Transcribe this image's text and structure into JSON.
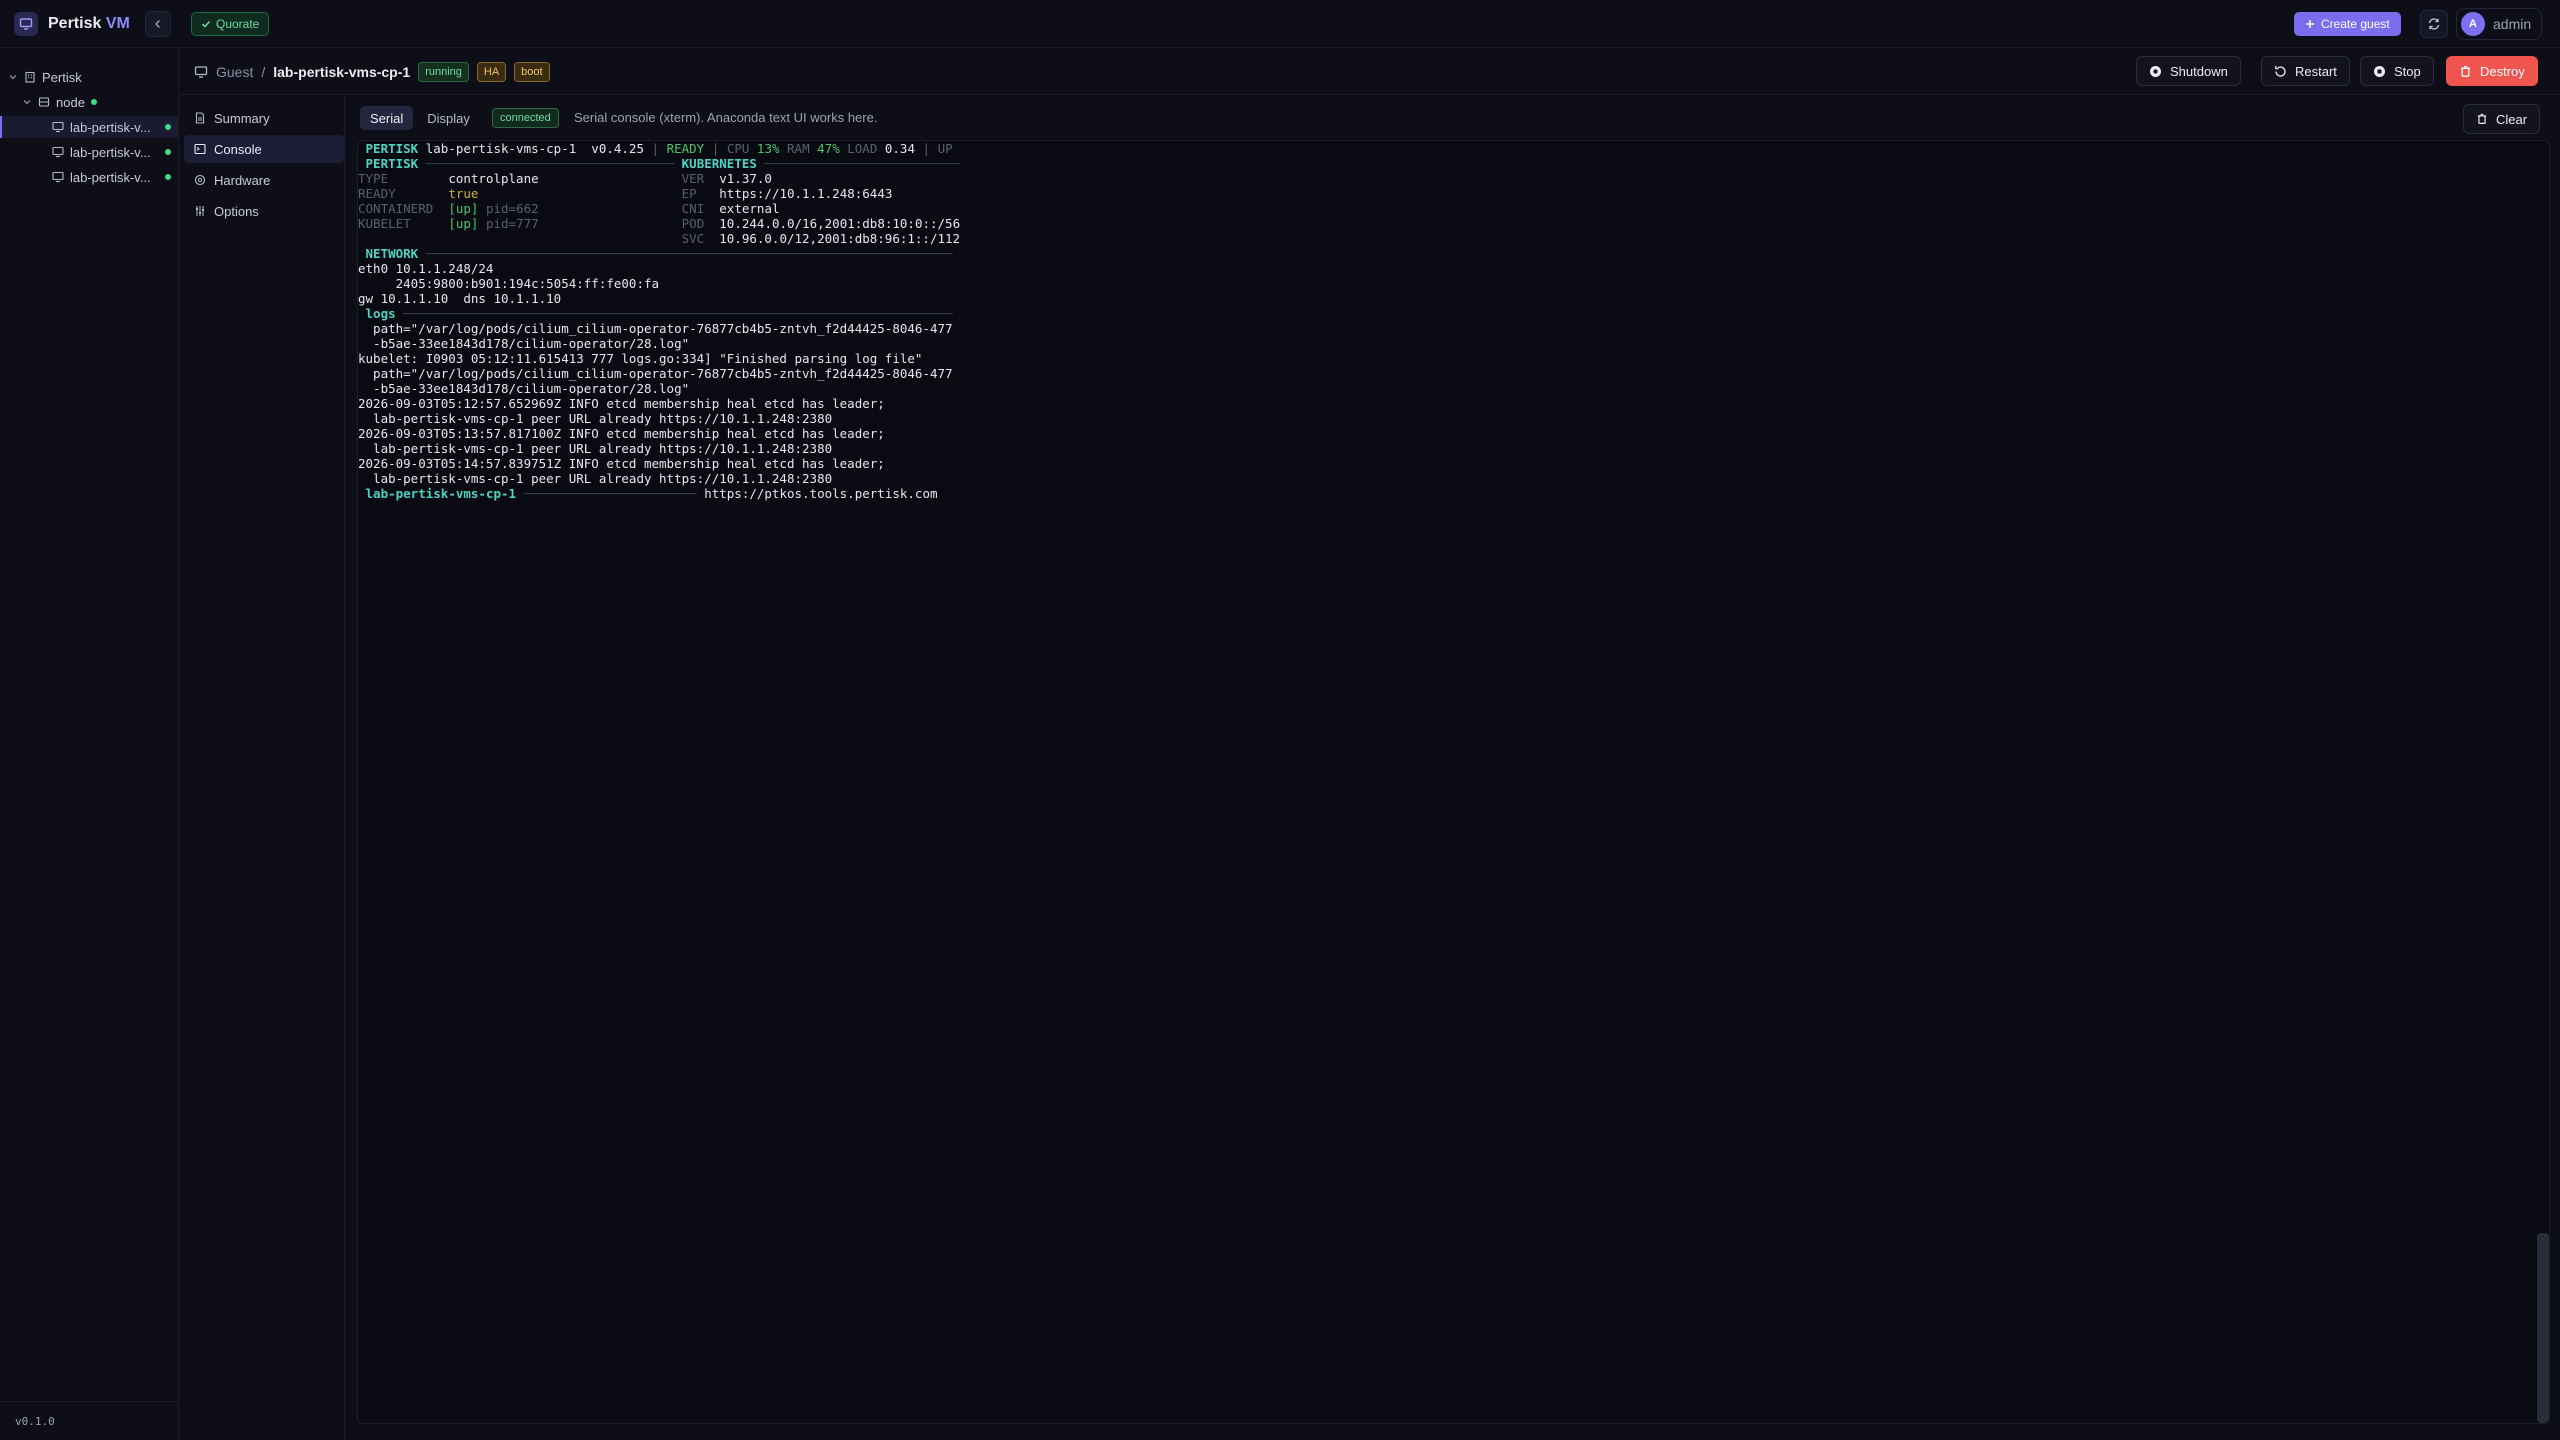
{
  "app": {
    "brand_primary": "Pertisk",
    "brand_accent": "VM",
    "quorate_label": "Quorate",
    "create_guest_label": "Create guest",
    "user_initial": "A",
    "user_name": "admin"
  },
  "sidebar": {
    "root_label": "Pertisk",
    "node_label": "node",
    "guests": [
      {
        "label": "lab-pertisk-v...",
        "status": "running"
      },
      {
        "label": "lab-pertisk-v...",
        "status": "running"
      },
      {
        "label": "lab-pertisk-v...",
        "status": "running"
      }
    ],
    "version": "v0.1.0"
  },
  "header": {
    "crumb_root": "Guest",
    "crumb_separator": "/",
    "crumb_current": "lab-pertisk-vms-cp-1",
    "badges": [
      "running",
      "HA",
      "boot"
    ],
    "actions": {
      "shutdown": "Shutdown",
      "restart": "Restart",
      "stop": "Stop",
      "destroy": "Destroy"
    }
  },
  "subnav": {
    "items": [
      "Summary",
      "Console",
      "Hardware",
      "Options"
    ],
    "active": "Console"
  },
  "console": {
    "tabs": [
      "Serial",
      "Display"
    ],
    "active_tab": "Serial",
    "status": "connected",
    "hint": "Serial console (xterm). Anaconda text UI works here.",
    "clear_label": "Clear",
    "lines": [
      " PERTISK lab-pertisk-vms-cp-1  v0.4.25 | READY | CPU 13% RAM 47% LOAD 0.34 | UP",
      " PERTISK ───────────────────────────────── KUBERNETES ──────────────────────────",
      "TYPE        controlplane                   VER  v1.37.0",
      "READY       true                           EP   https://10.1.1.248:6443",
      "CONTAINERD  [up] pid=662                   CNI  external",
      "KUBELET     [up] pid=777                   POD  10.244.0.0/16,2001:db8:10:0::/56",
      "                                           SVC  10.96.0.0/12,2001:db8:96:1::/112",
      " NETWORK ──────────────────────────────────────────────────────────────────────",
      "eth0 10.1.1.248/24",
      "     2405:9800:b901:194c:5054:ff:fe00:fa",
      "gw 10.1.1.10  dns 10.1.1.10",
      " logs ─────────────────────────────────────────────────────────────────────────",
      "  path=\"/var/log/pods/cilium_cilium-operator-76877cb4b5-zntvh_f2d44425-8046-477",
      "  -b5ae-33ee1843d178/cilium-operator/28.log\"",
      "kubelet: I0903 05:12:11.615413 777 logs.go:334] \"Finished parsing log file\"",
      "  path=\"/var/log/pods/cilium_cilium-operator-76877cb4b5-zntvh_f2d44425-8046-477",
      "  -b5ae-33ee1843d178/cilium-operator/28.log\"",
      "2026-09-03T05:12:57.652969Z INFO etcd membership heal etcd has leader;",
      "  lab-pertisk-vms-cp-1 peer URL already https://10.1.1.248:2380",
      "2026-09-03T05:13:57.817100Z INFO etcd membership heal etcd has leader;",
      "  lab-pertisk-vms-cp-1 peer URL already https://10.1.1.248:2380",
      "2026-09-03T05:14:57.839751Z INFO etcd membership heal etcd has leader;",
      "  lab-pertisk-vms-cp-1 peer URL already https://10.1.1.248:2380",
      " lab-pertisk-vms-cp-1 ─────────────────────── https://ptkos.tools.pertisk.com"
    ]
  },
  "colors": {
    "accent": "#7c6cf0",
    "status_green": "#3ddc84",
    "danger": "#f0544f",
    "warning": "#f1c56a",
    "terminal_cyan": "#4fd3c4"
  }
}
